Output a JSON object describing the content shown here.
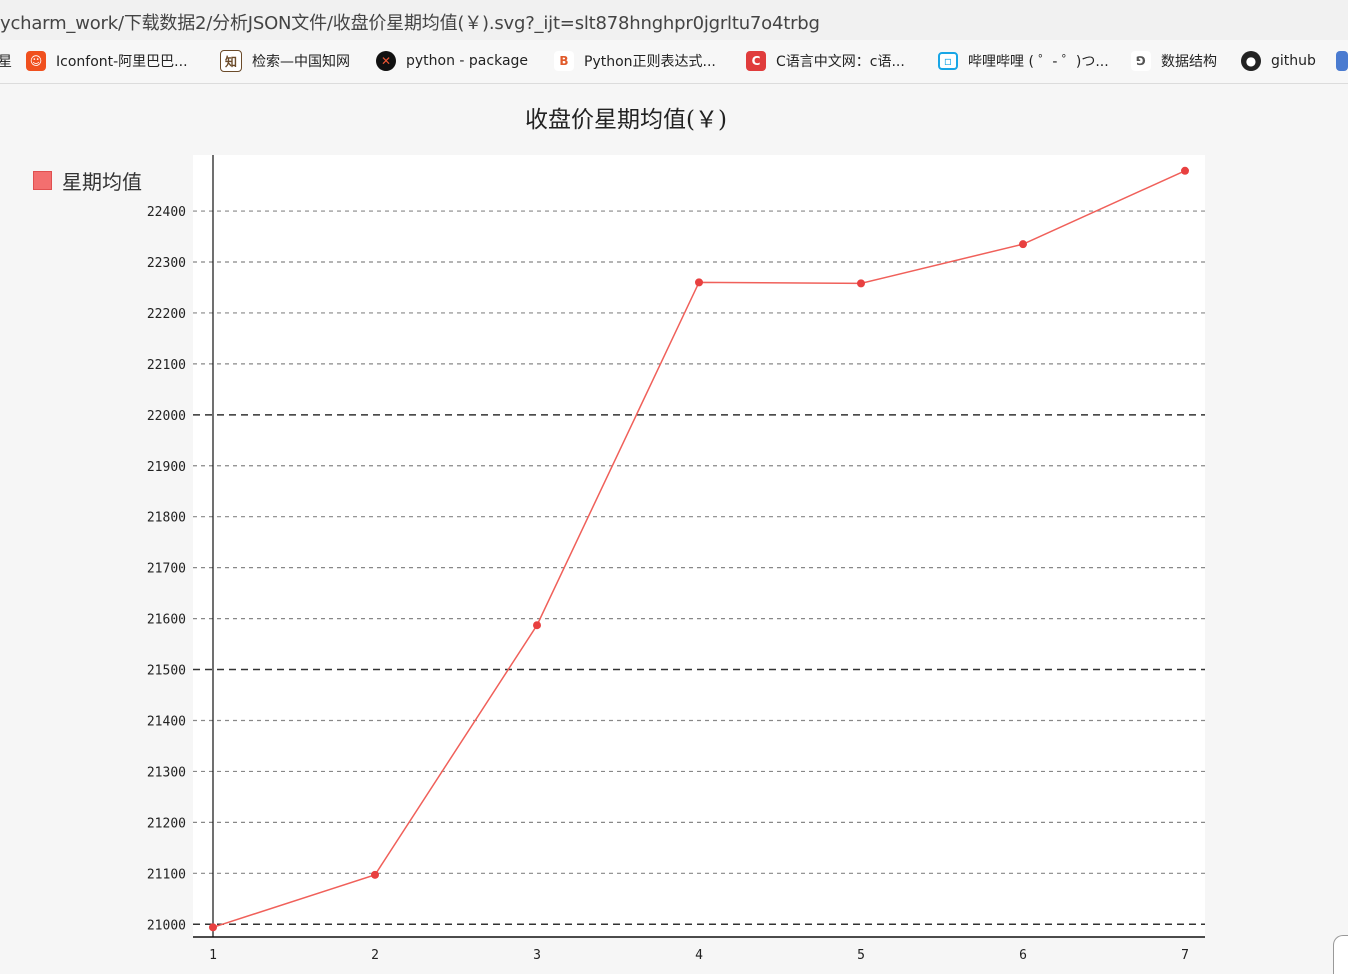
{
  "browser": {
    "url": "ycharm_work/下载数据2/分析JSON文件/收盘价星期均值(￥).svg?_ijt=slt878hnghpr0jgrltu7o4trbg",
    "bookmarks": [
      {
        "label": "Iconfont-阿里巴巴...",
        "icon": "iconfont-icon",
        "color": "#f0501e"
      },
      {
        "label": "检索—中国知网",
        "icon": "cnki-icon",
        "color": "#6b4b2a"
      },
      {
        "label": "python - package",
        "icon": "python-package-icon",
        "color": "#111111"
      },
      {
        "label": "Python正则表达式...",
        "icon": "regex-site-icon",
        "color": "#e05a2a"
      },
      {
        "label": "C语言中文网：c语...",
        "icon": "c-language-icon",
        "color": "#e03c3c"
      },
      {
        "label": "哔哩哔哩 ( ゜- ゜)つ...",
        "icon": "bilibili-icon",
        "color": "#19a6e6"
      },
      {
        "label": "数据结构",
        "icon": "data-structure-icon",
        "color": "#555555"
      },
      {
        "label": "github",
        "icon": "github-icon",
        "color": "#222222"
      }
    ],
    "bookmark_cut_left": "星",
    "bookmark_cut_right": ""
  },
  "chart_data": {
    "type": "line",
    "title": "收盘价星期均值(￥)",
    "categories": [
      "1",
      "2",
      "3",
      "4",
      "5",
      "6",
      "7"
    ],
    "series": [
      {
        "name": "星期均值",
        "color": "#f0605a",
        "values": [
          20994,
          21097,
          21587,
          22260,
          22258,
          22335,
          22479
        ]
      }
    ],
    "y_ticks": [
      21000,
      21100,
      21200,
      21300,
      21400,
      21500,
      21600,
      21700,
      21800,
      21900,
      22000,
      22100,
      22200,
      22300,
      22400
    ],
    "major_ticks": [
      21000,
      21500,
      22000
    ],
    "ylim": [
      20975,
      22510
    ],
    "grid": true,
    "legend_position": "top-left",
    "xlabel": "",
    "ylabel": ""
  }
}
